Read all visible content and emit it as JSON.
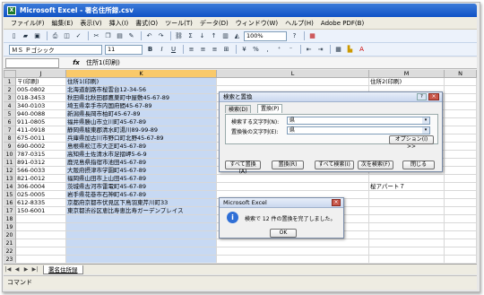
{
  "window": {
    "title": "Microsoft Excel - 署名住所録.csv",
    "app_icon": "excel-icon"
  },
  "menu": [
    "ファイル(F)",
    "編集(E)",
    "表示(V)",
    "挿入(I)",
    "書式(O)",
    "ツール(T)",
    "データ(D)",
    "ウィンドウ(W)",
    "ヘルプ(H)",
    "Adobe PDF(B)"
  ],
  "toolbar1": {
    "zoom": "100%"
  },
  "toolbar2": {
    "font": "ＭＳ Ｐゴシック",
    "size": "11"
  },
  "formula_bar": {
    "name_box": "",
    "fx": "fx",
    "content": "住所1(印刷)"
  },
  "columns": [
    "J",
    "K",
    "L",
    "M",
    "N"
  ],
  "rows": [
    {
      "num": "1",
      "j": "〒(印刷)",
      "k": "住所1(印刷)",
      "m": "住所2(印刷)"
    },
    {
      "num": "2",
      "j": "005-0802",
      "k": "北海道創路市桜雲台12-34-56",
      "m": ""
    },
    {
      "num": "3",
      "j": "018-3453",
      "k": "秋田県北秋田郡鷹巣町中屋敷45-67-89",
      "m": ""
    },
    {
      "num": "4",
      "j": "340-0103",
      "k": "埼玉県幸手市内国府間45-67-89",
      "m": ""
    },
    {
      "num": "5",
      "j": "940-0088",
      "k": "新潟県長岡市柏町45-67-89",
      "m": ""
    },
    {
      "num": "6",
      "j": "911-0805",
      "k": "福井県勝山市立川町45-67-89",
      "m": ""
    },
    {
      "num": "7",
      "j": "411-0918",
      "k": "静岡県駿東郡清水町湯川89-99-89",
      "m": ""
    },
    {
      "num": "8",
      "j": "675-0011",
      "k": "兵庫県加古川市野口町北野45-67-89",
      "m": ""
    },
    {
      "num": "9",
      "j": "690-0002",
      "k": "島根県松江市大正町45-67-89",
      "m": ""
    },
    {
      "num": "10",
      "j": "787-0315",
      "k": "高知県土佐清水市足摺岬5-6-9",
      "m": ""
    },
    {
      "num": "11",
      "j": "891-0312",
      "k": "鹿児島県指宿市池田45-67-89",
      "m": ""
    },
    {
      "num": "12",
      "j": "566-0033",
      "k": "大阪府摂津市学園町45-67-89",
      "m": ""
    },
    {
      "num": "13",
      "j": "821-0012",
      "k": "福岡県山田市上山田45-67-89",
      "m": ""
    },
    {
      "num": "14",
      "j": "306-0004",
      "k": "茨城県古河市雷電町45-67-89",
      "m": "桜アパート７"
    },
    {
      "num": "15",
      "j": "025-0005",
      "k": "岩手県花巻市石神町45-67-89",
      "m": ""
    },
    {
      "num": "16",
      "j": "612-8335",
      "k": "京都府京都市伏見区下鳥羽東芹川町33",
      "m": ""
    },
    {
      "num": "17",
      "j": "150-6001",
      "k": "東京都渋谷区恵比寿恵比寿ガーデンプレイス",
      "m": ""
    },
    {
      "num": "18",
      "j": "",
      "k": "",
      "m": ""
    },
    {
      "num": "19",
      "j": "",
      "k": "",
      "m": ""
    },
    {
      "num": "20",
      "j": "",
      "k": "",
      "m": ""
    },
    {
      "num": "21",
      "j": "",
      "k": "",
      "m": ""
    },
    {
      "num": "22",
      "j": "",
      "k": "",
      "m": ""
    },
    {
      "num": "23",
      "j": "",
      "k": "",
      "m": ""
    }
  ],
  "replace_dialog": {
    "title": "検索と置換",
    "tabs": [
      "検索(D)",
      "置換(P)"
    ],
    "find_label": "検索する文字列(N):",
    "find_value": "県",
    "replace_label": "置換後の文字列(E):",
    "replace_value": "県",
    "options_btn": "オプション(I) >>",
    "buttons": [
      "すべて置換(A)",
      "置換(R)",
      "すべて検索(I)",
      "次を検索(F)",
      "閉じる"
    ]
  },
  "msg_dialog": {
    "title": "Microsoft Excel",
    "message": "検索で 12 件の置換を完了しました。",
    "ok": "OK"
  },
  "sheet_tab": "署名住所録",
  "status": "コマンド",
  "colors": {
    "selection": "#c7d9f3",
    "title_blue": "#0f52c6",
    "header_sel": "#f9c96a"
  }
}
